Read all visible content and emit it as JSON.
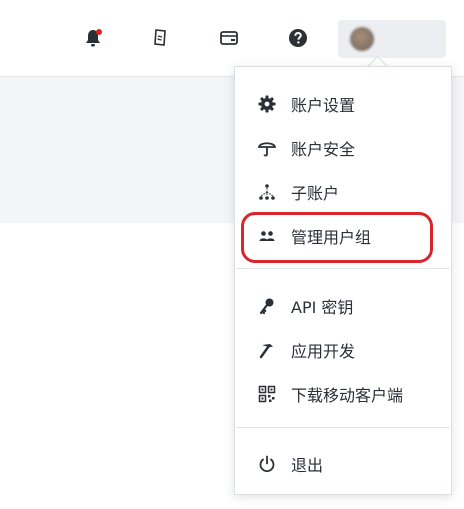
{
  "header": {
    "icons": [
      {
        "name": "notification-bell-icon",
        "has_badge": true,
        "badge_color": "#e02020"
      },
      {
        "name": "certificate-icon"
      },
      {
        "name": "wallet-icon"
      },
      {
        "name": "help-icon"
      }
    ],
    "user": {
      "avatar": "avatar"
    }
  },
  "colors": {
    "highlight": "#d9262b",
    "icon": "#2b2f36",
    "content_band": "#f3f5f8"
  },
  "menu": {
    "groups": [
      [
        {
          "label": "账户设置",
          "icon": "gear-icon"
        },
        {
          "label": "账户安全",
          "icon": "umbrella-icon"
        },
        {
          "label": "子账户",
          "icon": "hierarchy-icon"
        },
        {
          "label": "管理用户组",
          "icon": "user-group-icon",
          "highlighted": true
        }
      ],
      [
        {
          "label": "API 密钥",
          "icon": "key-icon"
        },
        {
          "label": "应用开发",
          "icon": "hammer-icon"
        },
        {
          "label": "下载移动客户端",
          "icon": "qr-code-icon"
        }
      ],
      [
        {
          "label": "退出",
          "icon": "power-icon"
        }
      ]
    ]
  }
}
